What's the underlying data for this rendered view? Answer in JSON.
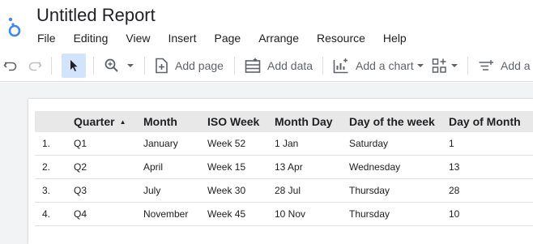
{
  "app": {
    "title": "Untitled Report",
    "brand_color": "#4285f4"
  },
  "menu": [
    "File",
    "Editing",
    "View",
    "Insert",
    "Page",
    "Arrange",
    "Resource",
    "Help"
  ],
  "toolbar": {
    "undo_icon": "undo-icon",
    "redo_icon": "redo-icon",
    "select_icon": "pointer-icon",
    "zoom_icon": "zoom-icon",
    "add_page_label": "Add page",
    "add_data_label": "Add data",
    "add_chart_label": "Add a chart",
    "controls_icon": "controls-icon",
    "add_control_label": "Add a c"
  },
  "table": {
    "headers": [
      "Quarter",
      "Month",
      "ISO Week",
      "Month Day",
      "Day of the week",
      "Day of Month"
    ],
    "sort_indicator": "▲",
    "rows": [
      {
        "index": "1.",
        "cells": [
          "Q1",
          "January",
          "Week 52",
          "1 Jan",
          "Saturday",
          "1"
        ]
      },
      {
        "index": "2.",
        "cells": [
          "Q2",
          "April",
          "Week 15",
          "13 Apr",
          "Wednesday",
          "13"
        ]
      },
      {
        "index": "3.",
        "cells": [
          "Q3",
          "July",
          "Week 30",
          "28 Jul",
          "Thursday",
          "28"
        ]
      },
      {
        "index": "4.",
        "cells": [
          "Q4",
          "November",
          "Week 45",
          "10 Nov",
          "Thursday",
          "10"
        ]
      }
    ]
  }
}
